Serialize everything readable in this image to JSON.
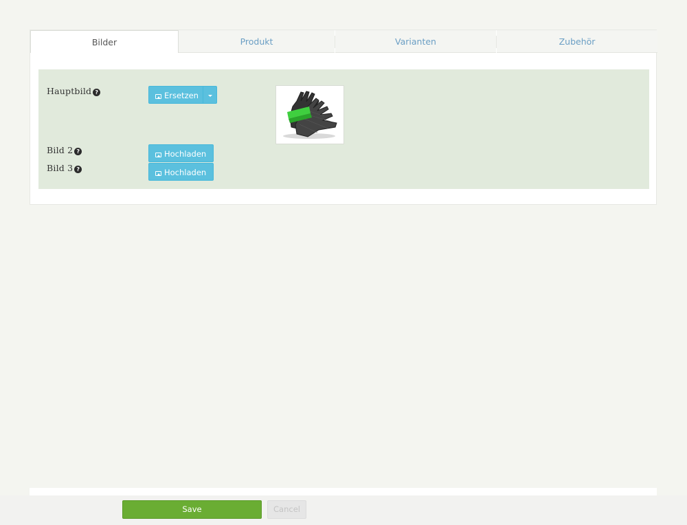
{
  "tabs": [
    {
      "label": "Bilder",
      "active": true
    },
    {
      "label": "Produkt",
      "active": false
    },
    {
      "label": "Varianten",
      "active": false
    },
    {
      "label": "Zubehör",
      "active": false
    }
  ],
  "images": {
    "main": {
      "label": "Hauptbild",
      "button_label": "Ersetzen",
      "has_image": true
    },
    "image2": {
      "label": "Bild 2",
      "button_label": "Hochladen"
    },
    "image3": {
      "label": "Bild 3",
      "button_label": "Hochladen"
    }
  },
  "help_glyph": "?",
  "footer": {
    "save_label": "Save",
    "cancel_label": "Cancel"
  },
  "colors": {
    "info_button": "#5bc0de",
    "save_button": "#6aad33",
    "link": "#6a9ec4",
    "panel_bg": "#e1eadc"
  }
}
